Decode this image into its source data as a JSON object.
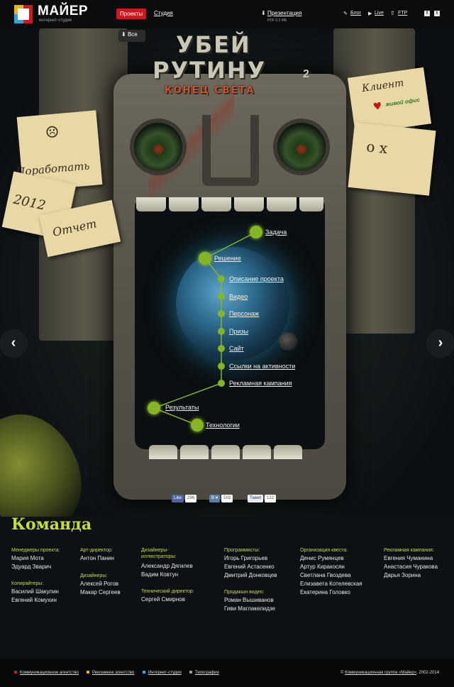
{
  "header": {
    "logo_title": "МАЙЕР",
    "logo_subtitle": "интернет-студия",
    "nav": {
      "projects": "Проекты",
      "studio": "Студия"
    },
    "presentation": {
      "label": "Презентация",
      "sub": "PDF 0.3 МБ"
    },
    "links": {
      "blog": "Блог",
      "live": "Live",
      "ftp": "FTP"
    },
    "social": {
      "facebook": "f",
      "twitter": "t"
    }
  },
  "hero": {
    "all_button": "Все",
    "title_line1": "УБЕЙ",
    "title_line2": "РУТИНУ",
    "title_line3": "КОНЕЦ СВЕТА",
    "title_num": "2",
    "notes": {
      "work": "Поработать",
      "year": "2012",
      "report": "Отчет",
      "client": "Клиент",
      "client_brand": "живой офис",
      "face": "o x"
    },
    "menu": {
      "task": "Задача",
      "solution": "Решение",
      "description": "Описание проекта",
      "video": "Видео",
      "character": "Персонаж",
      "prizes": "Призы",
      "site": "Сайт",
      "activity_links": "Ссылки на активности",
      "ad_campaign": "Рекламная кампания",
      "results": "Результаты",
      "technologies": "Технологии"
    },
    "prev_arrow": "‹",
    "next_arrow": "›"
  },
  "share": {
    "fb": {
      "label": "Like",
      "count": "296"
    },
    "vk": {
      "label": "В ♥",
      "count": "503"
    },
    "tw": {
      "label": "Tweet",
      "count": "122"
    }
  },
  "team": {
    "title": "Команда",
    "col1": {
      "role1": "Менеджеры проекта:",
      "p1": "Мария Мота",
      "p2": "Эдуард Зварич",
      "role2": "Копирайтеры:",
      "p3": "Василий Шакулин",
      "p4": "Евгений Комухин"
    },
    "col2": {
      "role1": "Арт-директор:",
      "p1": "Антон Панин",
      "role2": "Дизайнеры:",
      "p2": "Алексей Рогов",
      "p3": "Макар Сергеев"
    },
    "col3": {
      "role1a": "Дизайнеры-",
      "role1b": "иллюстраторы:",
      "p1": "Александр Дягилев",
      "p2": "Вадим Ковтун",
      "role2": "Технический директор:",
      "p3": "Сергей Смирнов"
    },
    "col4": {
      "role1": "Программисты:",
      "p1": "Игорь Григорьев",
      "p2": "Евгений Астасенко",
      "p3": "Дмитрий Донковцев",
      "role2": "Продакшн видео:",
      "p4": "Роман Вышиванов",
      "p5": "Гиви Маглакелидзе"
    },
    "col5": {
      "role1": "Организация квеста:",
      "p1": "Денис Румянцев",
      "p2": "Артур Киракосян",
      "p3": "Светлана Гвоздева",
      "p4": "Елизавета Котелевская",
      "p5": "Екатерина Головко"
    },
    "col6": {
      "role1": "Рекламная кампания:",
      "p1": "Евгения Чуманина",
      "p2": "Анастасия Чуракова",
      "p3": "Дарья Зорина"
    }
  },
  "footer": {
    "items": [
      "Коммуникационное агентство",
      "Рекламное агентство",
      "Интернет-студия",
      "Типографии"
    ],
    "colors": [
      "#d0181c",
      "#e8b417",
      "#2aa6d8",
      "#9a9a9a"
    ],
    "copyright_prefix": "© ",
    "copyright_link": "Коммуникационная группа «Майер»",
    "copyright_suffix": ", 2002-2014"
  }
}
